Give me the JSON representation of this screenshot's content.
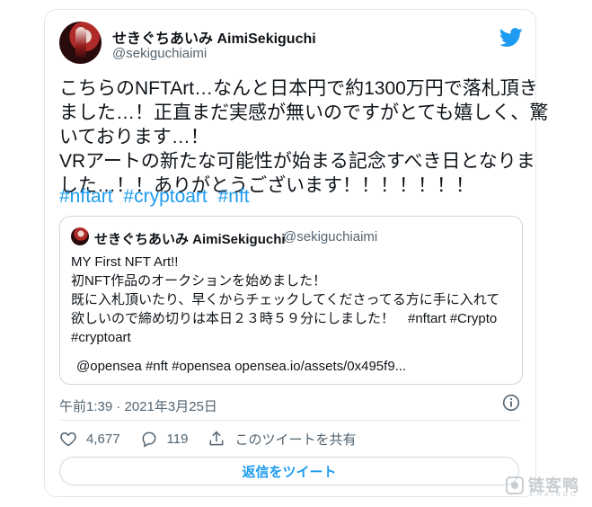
{
  "tweet": {
    "display_name": "せきぐちあいみ AimiSekiguchi",
    "handle": "@sekiguchiaimi",
    "text_lines": [
      "こちらのNFTArt…なんと日本円で約1300万円で落札頂き",
      "ました…！正直まだ実感が無いのですがとても嬉しく、驚",
      "いております…！",
      "VRアートの新たな可能性が始まる記念すべき日となりま",
      "した…！！ありがとうございます！！！！！！！"
    ],
    "hashtags": [
      "#nftart",
      "#cryptoart",
      "#nft"
    ],
    "timestamp": "午前1:39 · 2021年3月25日"
  },
  "quote": {
    "display_name": "せきぐちあいみ AimiSekiguchi",
    "handle": "@sekiguchiaimi",
    "text_lines": [
      "MY First NFT Art!!",
      "初NFT作品のオークションを始めました！",
      "既に入札頂いたり、早くからチェックしてくださってる方に手に入れて",
      "欲しいので締め切りは本日２３時５９分にしました！　#nftart #Crypto",
      "#cryptoart"
    ],
    "link_line": "@opensea #nft #opensea opensea.io/assets/0x495f9..."
  },
  "actions": {
    "likes": "4,677",
    "replies": "119",
    "share_label": "このツイートを共有"
  },
  "reply_button_label": "返信をツイート",
  "colors": {
    "accent": "#1d9bf0",
    "muted": "#536471",
    "border": "#cfd9de"
  },
  "icons": {
    "brand": "twitter-bird-icon",
    "info": "info-icon",
    "like": "heart-icon",
    "reply": "speech-bubble-icon",
    "share": "share-icon"
  },
  "watermark": {
    "text": "链客鸭",
    "sub": "CHAINGO"
  }
}
